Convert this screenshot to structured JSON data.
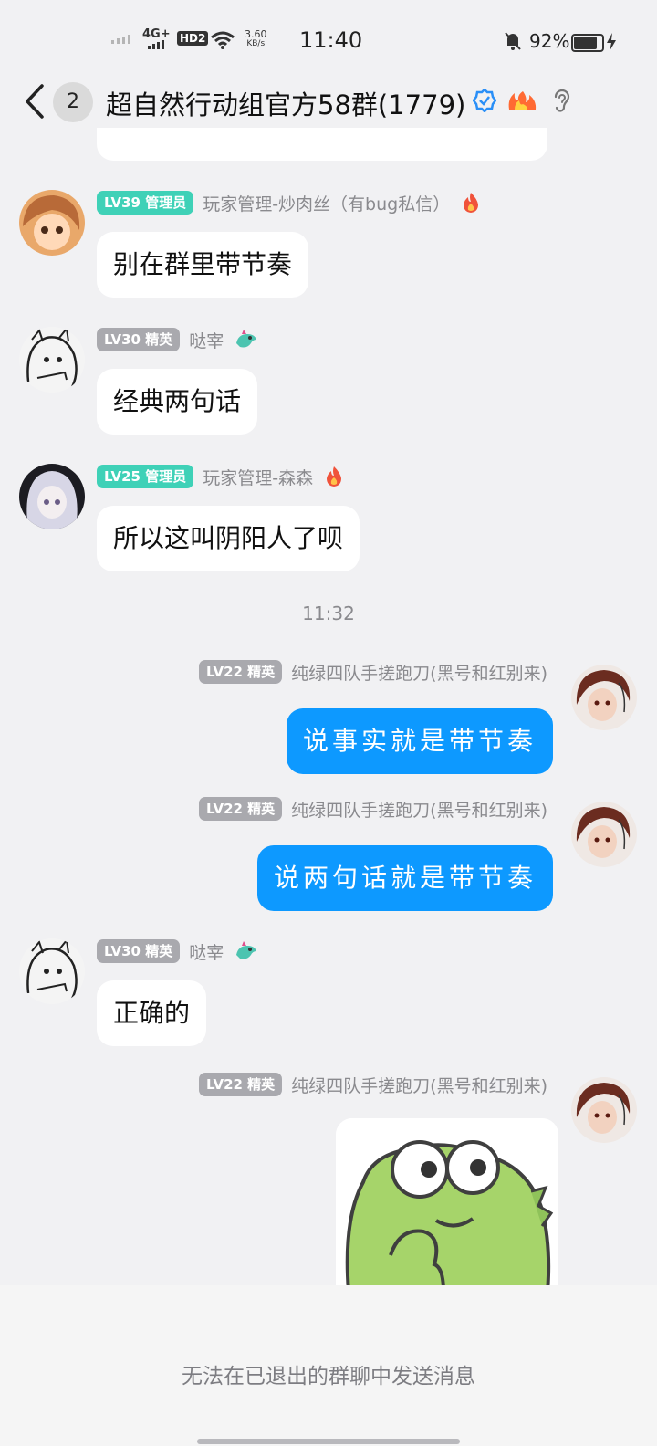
{
  "status_bar": {
    "network": "4G+",
    "hd": "HD2",
    "speed_value": "3.60",
    "speed_unit": "KB/s",
    "time": "11:40",
    "battery": "92%"
  },
  "header": {
    "unread_count": "2",
    "title": "超自然行动组官方58群(1779)"
  },
  "messages": [
    {
      "level": "LV39 管理员",
      "nick": "玩家管理-炒肉丝（有bug私信）",
      "text": "别在群里带节奏"
    },
    {
      "level": "LV30 精英",
      "nick": "哒宰",
      "text": "经典两句话"
    },
    {
      "level": "LV25 管理员",
      "nick": "玩家管理-森森",
      "text": "所以这叫阴阳人了呗"
    },
    {
      "level": "LV22 精英",
      "nick": "纯绿四队手搓跑刀(黑号和红别来)",
      "text": "说事实就是带节奏"
    },
    {
      "level": "LV22 精英",
      "nick": "纯绿四队手搓跑刀(黑号和红别来)",
      "text": "说两句话就是带节奏"
    },
    {
      "level": "LV30 精英",
      "nick": "哒宰",
      "text": "正确的"
    },
    {
      "level": "LV22 精英",
      "nick": "纯绿四队手搓跑刀(黑号和红别来)"
    }
  ],
  "timestamp": "11:32",
  "footer": {
    "notice": "无法在已退出的群聊中发送消息"
  },
  "colors": {
    "out_bubble": "#0d99ff",
    "admin_badge": "#3fd1b7",
    "elite_badge": "#a9a9ae",
    "background": "#f1f1f3"
  }
}
